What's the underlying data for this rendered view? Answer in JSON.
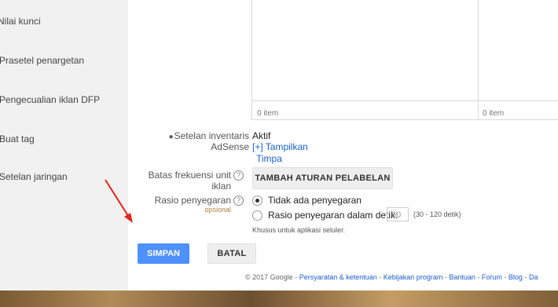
{
  "sidebar": {
    "items": [
      {
        "label": "Nilai kunci"
      },
      {
        "label": "Prasetel penargetan"
      },
      {
        "label": "Pengecualian iklan DFP"
      },
      {
        "label": "Buat tag"
      },
      {
        "label": "Setelan jaringan"
      }
    ]
  },
  "panel": {
    "left_count": "0 item",
    "right_count": "0 item"
  },
  "adsense": {
    "label": "Setelan inventaris AdSense",
    "status": "Aktif",
    "show_link": "[+] Tampilkan",
    "override_link": "Timpa"
  },
  "frequency": {
    "label_line1": "Batas frekuensi unit",
    "label_line2": "iklan",
    "button": "TAMBAH ATURAN PELABELAN"
  },
  "refresh": {
    "label": "Rasio penyegaran",
    "optional": "opsional",
    "option_none": "Tidak ada penyegaran",
    "option_seconds": "Rasio penyegaran dalam detik:",
    "seconds_value": "60",
    "seconds_range": "(30 - 120 detik)",
    "note": "Khusus untuk aplikasi seluler."
  },
  "help_glyph": "?",
  "buttons": {
    "save": "SIMPAN",
    "cancel": "BATAL"
  },
  "footer": {
    "copyright": "© 2017 Google",
    "links": [
      "Persyaratan & ketentuan",
      "Kebijakan program",
      "Bantuan",
      "Forum",
      "Blog",
      "Da"
    ]
  },
  "colors": {
    "accent": "#4d90fe",
    "link": "#1a5fcf",
    "arrow": "#e0241b"
  },
  "icons": {
    "adsense": "people-icon",
    "help": "help-circle-icon",
    "annotation": "red-arrow"
  }
}
